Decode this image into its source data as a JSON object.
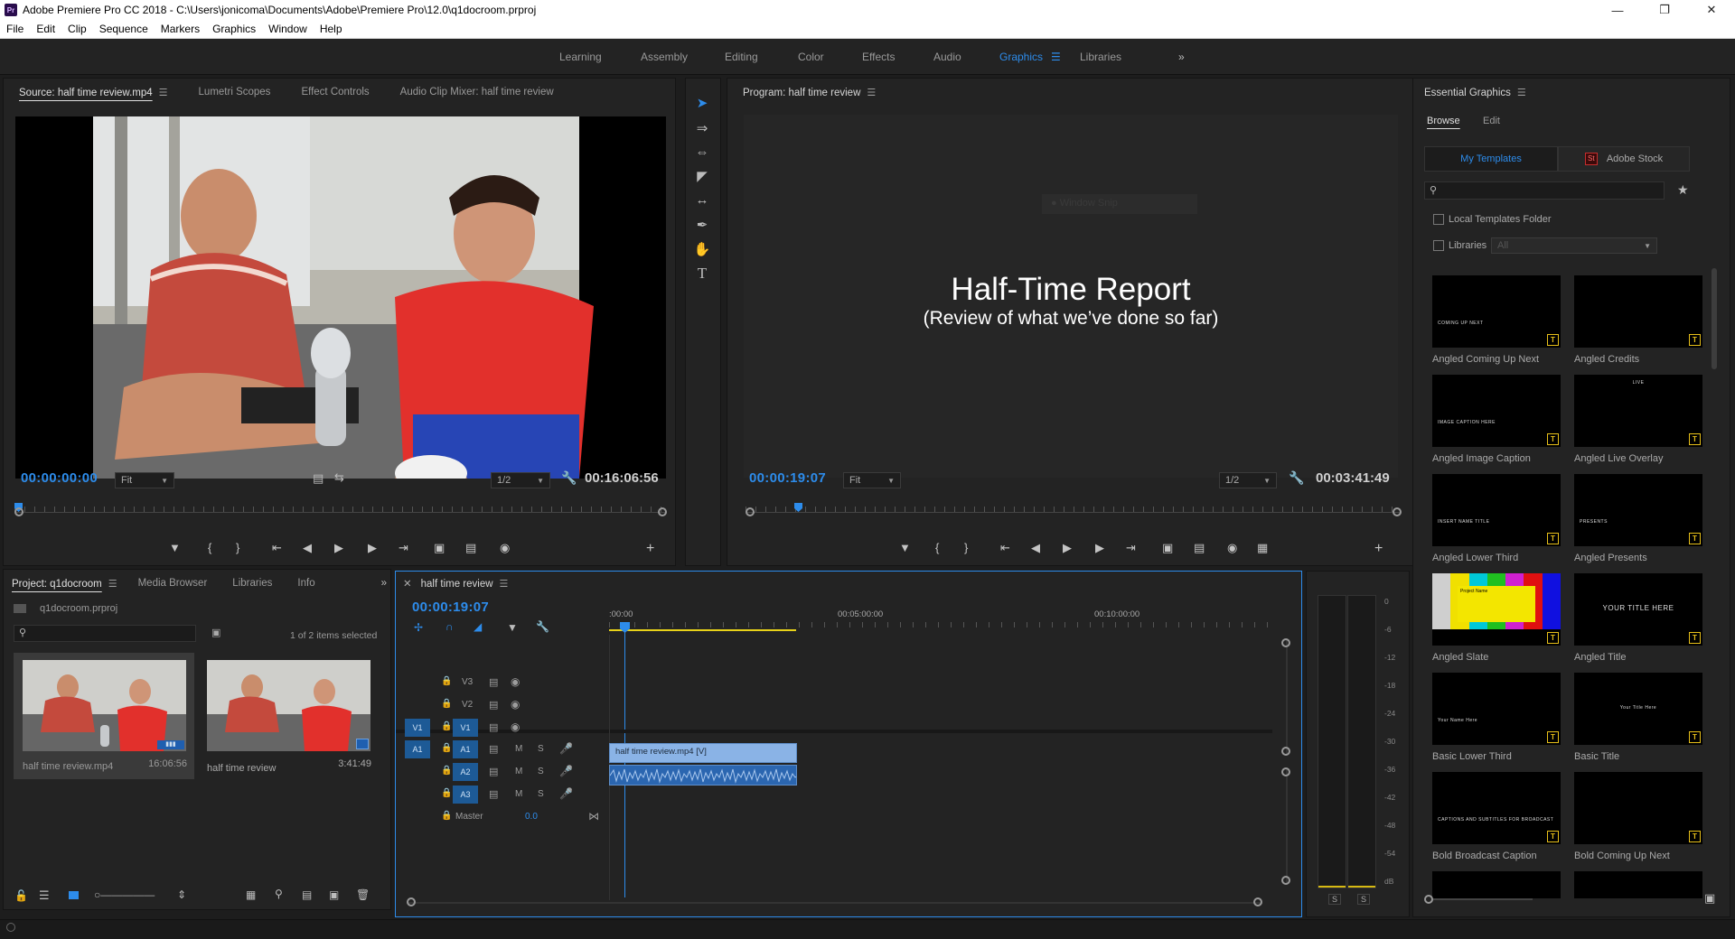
{
  "app": {
    "title": "Adobe Premiere Pro CC 2018 - C:\\Users\\jonicoma\\Documents\\Adobe\\Premiere Pro\\12.0\\q1docroom.prproj",
    "icon_label": "Pr"
  },
  "menu": [
    "File",
    "Edit",
    "Clip",
    "Sequence",
    "Markers",
    "Graphics",
    "Window",
    "Help"
  ],
  "workspaces": [
    "Learning",
    "Assembly",
    "Editing",
    "Color",
    "Effects",
    "Audio",
    "Graphics",
    "Libraries"
  ],
  "active_workspace": "Graphics",
  "source_panel": {
    "tabs": [
      "Source: half time review.mp4",
      "Lumetri Scopes",
      "Effect Controls",
      "Audio Clip Mixer: half time review"
    ],
    "timecode": "00:00:00:00",
    "fit": "Fit",
    "resolution": "1/2",
    "duration": "00:16:06:56"
  },
  "program_panel": {
    "tab": "Program: half time review",
    "timecode": "00:00:19:07",
    "fit": "Fit",
    "resolution": "1/2",
    "duration": "00:03:41:49",
    "ghost_label": "Window Snip",
    "title_main": "Half-Time Report",
    "title_sub": "(Review of what we’ve done so far)"
  },
  "project_panel": {
    "tabs": [
      "Project: q1docroom",
      "Media Browser",
      "Libraries",
      "Info"
    ],
    "file": "q1docroom.prproj",
    "selection_status": "1 of 2 items selected",
    "items": [
      {
        "name": "half time review.mp4",
        "duration": "16:06:56"
      },
      {
        "name": "half time review",
        "duration": "3:41:49"
      }
    ]
  },
  "timeline": {
    "tab": "half time review",
    "timecode": "00:00:19:07",
    "ruler_labels": [
      ":00:00",
      "00:05:00:00",
      "00:10:00:00"
    ],
    "tracks_video": [
      "V3",
      "V2",
      "V1"
    ],
    "tracks_audio": [
      "A1",
      "A2",
      "A3"
    ],
    "master_label": "Master",
    "master_value": "0.0",
    "video_clip": "half time review.mp4 [V]",
    "source_patch_video": "V1",
    "source_patch_audio": "A1",
    "mute_label": "M",
    "solo_label": "S"
  },
  "meter": {
    "labels": [
      "0",
      "-6",
      "-12",
      "-18",
      "-24",
      "-30",
      "-36",
      "-42",
      "-48",
      "-54",
      "dB"
    ],
    "solo_buttons": [
      "S",
      "S"
    ]
  },
  "essential_graphics": {
    "title": "Essential Graphics",
    "tabs": [
      "Browse",
      "Edit"
    ],
    "sub_tabs": [
      "My Templates",
      "Adobe Stock"
    ],
    "stock_badge": "St",
    "local_templates": "Local Templates Folder",
    "libraries": "Libraries",
    "libraries_dropdown": "All",
    "badge_letter": "T",
    "templates": [
      {
        "name": "Angled Coming Up Next",
        "caption": "COMING UP NEXT"
      },
      {
        "name": "Angled Credits",
        "caption": ""
      },
      {
        "name": "Angled Image Caption",
        "caption": "IMAGE CAPTION HERE"
      },
      {
        "name": "Angled Live Overlay",
        "caption": "LIVE"
      },
      {
        "name": "Angled Lower Third",
        "caption": "INSERT NAME TITLE"
      },
      {
        "name": "Angled Presents",
        "caption": "PRESENTS"
      },
      {
        "name": "Angled Slate",
        "caption": "Project Name"
      },
      {
        "name": "Angled Title",
        "caption": "YOUR TITLE HERE"
      },
      {
        "name": "Basic Lower Third",
        "caption": "Your Name Here"
      },
      {
        "name": "Basic Title",
        "caption": "Your Title Here"
      },
      {
        "name": "Bold Broadcast Caption",
        "caption": "CAPTIONS AND SUBTITLES FOR BROADCAST"
      },
      {
        "name": "Bold Coming Up Next",
        "caption": ""
      }
    ]
  },
  "colors": {
    "accent": "#2d8ceb",
    "panel": "#232323",
    "clip_video": "#8ab3e6",
    "clip_audio": "#2b66b0",
    "badge": "#e8c019"
  }
}
